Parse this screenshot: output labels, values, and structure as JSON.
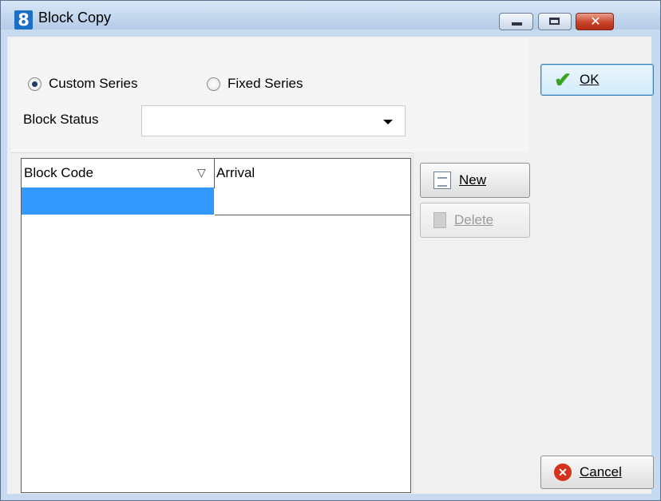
{
  "window": {
    "title": "Block Copy",
    "app_icon_glyph": "8",
    "controls": {
      "minimize": "minimize-icon",
      "maximize": "maximize-icon",
      "close": "close-icon"
    }
  },
  "series": {
    "custom_label": "Custom Series",
    "fixed_label": "Fixed Series",
    "selected": "Custom Series"
  },
  "block_status": {
    "label": "Block Status",
    "value": ""
  },
  "grid": {
    "columns": [
      "Block Code",
      "Arrival"
    ],
    "rows": [
      [
        "",
        ""
      ]
    ]
  },
  "actions": {
    "new_label": "New",
    "delete_label": "Delete"
  },
  "dialog": {
    "ok_label": "OK",
    "cancel_label": "Cancel"
  },
  "colors": {
    "selection": "#3399ff",
    "close_button": "#c9432a",
    "ok_check": "#3aa51c"
  }
}
